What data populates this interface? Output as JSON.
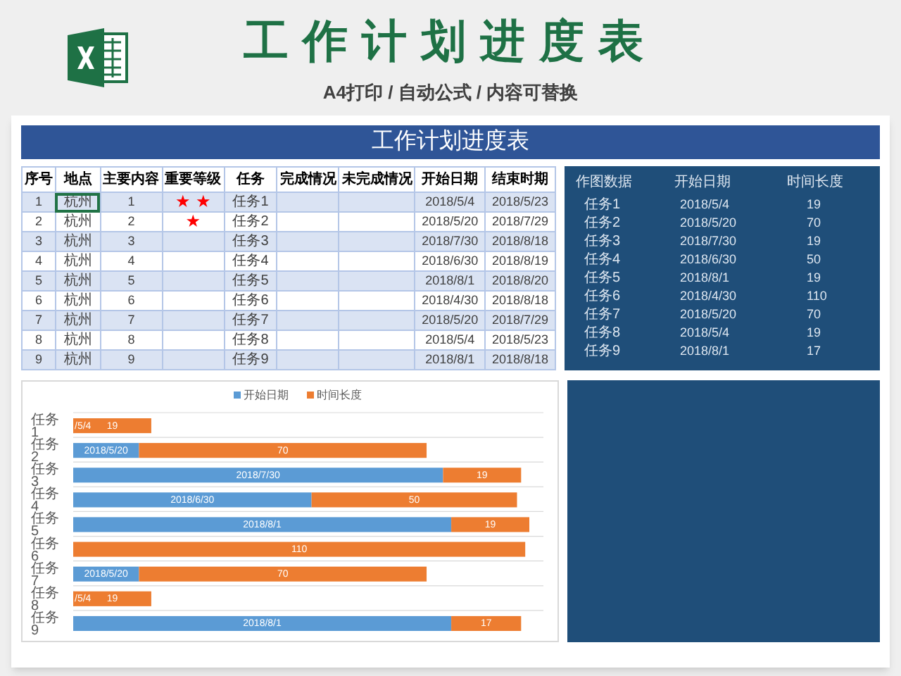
{
  "header": {
    "title": "工作计划进度表",
    "subtitle": "A4打印 / 自动公式 / 内容可替换"
  },
  "sheet": {
    "title": "工作计划进度表",
    "table": {
      "columns": [
        "序号",
        "地点",
        "主要内容",
        "重要等级",
        "任务",
        "完成情况",
        "未完成情况",
        "开始日期",
        "结束时期"
      ],
      "rows": [
        {
          "no": "1",
          "location": "杭州",
          "content": "1",
          "importance": "★ ★",
          "task": "任务1",
          "start": "2018/5/4",
          "end": "2018/5/23",
          "location_selected": true
        },
        {
          "no": "2",
          "location": "杭州",
          "content": "2",
          "importance": "★",
          "task": "任务2",
          "start": "2018/5/20",
          "end": "2018/7/29",
          "location_selected": false
        },
        {
          "no": "3",
          "location": "杭州",
          "content": "3",
          "task": "任务3",
          "start": "2018/7/30",
          "end": "2018/8/18",
          "location_selected": false
        },
        {
          "no": "4",
          "location": "杭州",
          "content": "4",
          "task": "任务4",
          "start": "2018/6/30",
          "end": "2018/8/19",
          "location_selected": false
        },
        {
          "no": "5",
          "location": "杭州",
          "content": "5",
          "task": "任务5",
          "start": "2018/8/1",
          "end": "2018/8/20",
          "location_selected": false
        },
        {
          "no": "6",
          "location": "杭州",
          "content": "6",
          "task": "任务6",
          "start": "2018/4/30",
          "end": "2018/8/18",
          "location_selected": false
        },
        {
          "no": "7",
          "location": "杭州",
          "content": "7",
          "task": "任务7",
          "start": "2018/5/20",
          "end": "2018/7/29",
          "location_selected": false
        },
        {
          "no": "8",
          "location": "杭州",
          "content": "8",
          "task": "任务8",
          "start": "2018/5/4",
          "end": "2018/5/23",
          "location_selected": false
        },
        {
          "no": "9",
          "location": "杭州",
          "content": "9",
          "task": "任务9",
          "start": "2018/8/1",
          "end": "2018/8/18",
          "location_selected": false
        }
      ]
    },
    "chart_source": {
      "columns": [
        "作图数据",
        "开始日期",
        "时间长度"
      ],
      "rows": [
        [
          "任务1",
          "2018/5/4",
          "19"
        ],
        [
          "任务2",
          "2018/5/20",
          "70"
        ],
        [
          "任务3",
          "2018/7/30",
          "19"
        ],
        [
          "任务4",
          "2018/6/30",
          "50"
        ],
        [
          "任务5",
          "2018/8/1",
          "19"
        ],
        [
          "任务6",
          "2018/4/30",
          "110"
        ],
        [
          "任务7",
          "2018/5/20",
          "70"
        ],
        [
          "任务8",
          "2018/5/4",
          "19"
        ],
        [
          "任务9",
          "2018/8/1",
          "17"
        ]
      ]
    },
    "chart": {
      "chart_data": {
        "type": "bar",
        "orientation": "horizontal",
        "stacked": true,
        "legend": "top",
        "categories": [
          [
            "任务",
            "1"
          ],
          [
            "任务",
            "2"
          ],
          [
            "任务",
            "3"
          ],
          [
            "任务",
            "4"
          ],
          [
            "任务",
            "5"
          ],
          [
            "任务",
            "6"
          ],
          [
            "任务",
            "7"
          ],
          [
            "任务",
            "8"
          ],
          [
            "任务",
            "9"
          ]
        ],
        "series": [
          {
            "name": "开始日期",
            "color": "#5b9bd5",
            "values": [
              0,
              16,
              90,
              58,
              92,
              0,
              16,
              0,
              92
            ],
            "value_labels": [
              "/5/4",
              "2018/5/20",
              "2018/7/30",
              "2018/6/30",
              "2018/8/1",
              null,
              "2018/5/20",
              "/5/4",
              "2018/8/1"
            ]
          },
          {
            "name": "时间长度",
            "color": "#ed7d31",
            "values": [
              19,
              70,
              19,
              50,
              19,
              110,
              70,
              19,
              17
            ],
            "value_labels": [
              "19",
              "70",
              "19",
              "50",
              "19",
              "110",
              "70",
              "19",
              "17"
            ]
          }
        ]
      }
    }
  }
}
